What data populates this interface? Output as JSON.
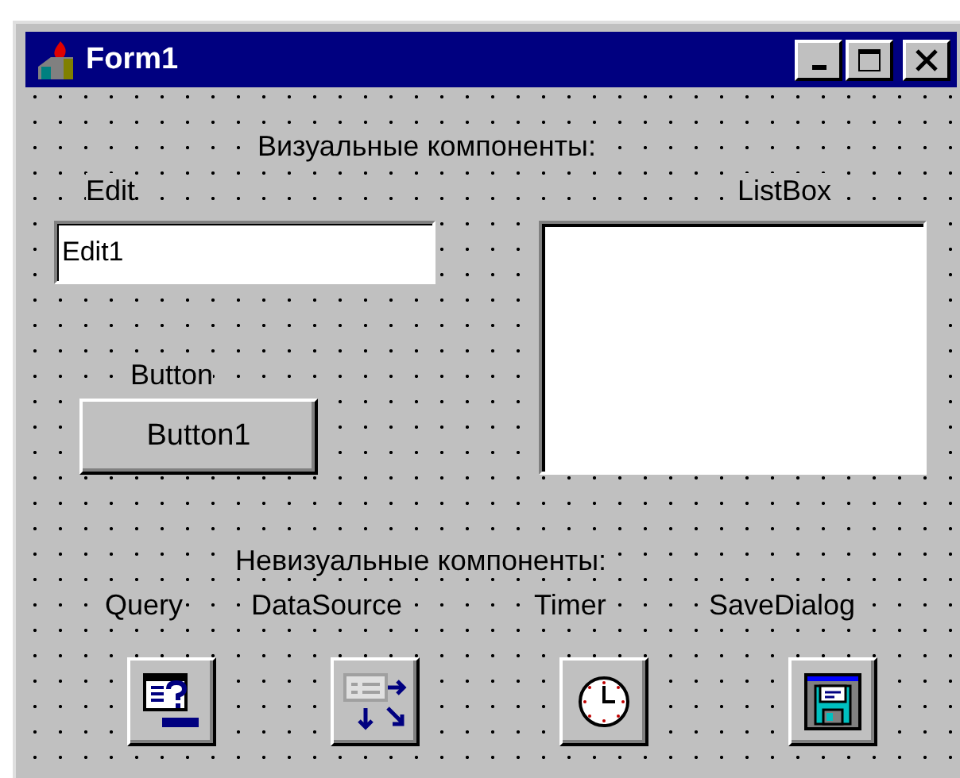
{
  "window": {
    "title": "Form1"
  },
  "visual": {
    "heading": "Визуальные компоненты:",
    "edit": {
      "label": "Edit",
      "value": "Edit1"
    },
    "listbox": {
      "label": "ListBox"
    },
    "button": {
      "label": "Button",
      "caption": "Button1"
    }
  },
  "nonvisual": {
    "heading": "Невизуальные компоненты:",
    "components": [
      {
        "label": "Query",
        "kind": "query"
      },
      {
        "label": "DataSource",
        "kind": "datasource"
      },
      {
        "label": "Timer",
        "kind": "timer"
      },
      {
        "label": "SaveDialog",
        "kind": "savedialog"
      }
    ]
  }
}
